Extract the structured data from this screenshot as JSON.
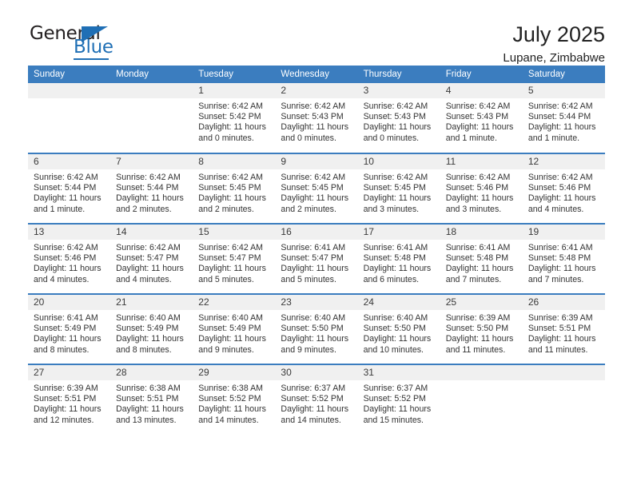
{
  "brand": {
    "name_top": "General",
    "name_bottom": "Blue",
    "accent_color": "#1f6fb5"
  },
  "header": {
    "title": "July 2025",
    "subtitle": "Lupane, Zimbabwe"
  },
  "theme": {
    "header_row_background": "#3b7dbf",
    "header_row_text": "#ffffff",
    "daynum_background": "#f0f0f0",
    "row_divider": "#3b7dbf"
  },
  "calendar": {
    "weekday_headers": [
      "Sunday",
      "Monday",
      "Tuesday",
      "Wednesday",
      "Thursday",
      "Friday",
      "Saturday"
    ],
    "labels": {
      "sunrise": "Sunrise:",
      "sunset": "Sunset:",
      "daylight": "Daylight:"
    },
    "weeks": [
      [
        {
          "day": "",
          "sunrise": "",
          "sunset": "",
          "daylight_1": "",
          "daylight_2": ""
        },
        {
          "day": "",
          "sunrise": "",
          "sunset": "",
          "daylight_1": "",
          "daylight_2": ""
        },
        {
          "day": "1",
          "sunrise": "Sunrise: 6:42 AM",
          "sunset": "Sunset: 5:42 PM",
          "daylight_1": "Daylight: 11 hours",
          "daylight_2": "and 0 minutes."
        },
        {
          "day": "2",
          "sunrise": "Sunrise: 6:42 AM",
          "sunset": "Sunset: 5:43 PM",
          "daylight_1": "Daylight: 11 hours",
          "daylight_2": "and 0 minutes."
        },
        {
          "day": "3",
          "sunrise": "Sunrise: 6:42 AM",
          "sunset": "Sunset: 5:43 PM",
          "daylight_1": "Daylight: 11 hours",
          "daylight_2": "and 0 minutes."
        },
        {
          "day": "4",
          "sunrise": "Sunrise: 6:42 AM",
          "sunset": "Sunset: 5:43 PM",
          "daylight_1": "Daylight: 11 hours",
          "daylight_2": "and 1 minute."
        },
        {
          "day": "5",
          "sunrise": "Sunrise: 6:42 AM",
          "sunset": "Sunset: 5:44 PM",
          "daylight_1": "Daylight: 11 hours",
          "daylight_2": "and 1 minute."
        }
      ],
      [
        {
          "day": "6",
          "sunrise": "Sunrise: 6:42 AM",
          "sunset": "Sunset: 5:44 PM",
          "daylight_1": "Daylight: 11 hours",
          "daylight_2": "and 1 minute."
        },
        {
          "day": "7",
          "sunrise": "Sunrise: 6:42 AM",
          "sunset": "Sunset: 5:44 PM",
          "daylight_1": "Daylight: 11 hours",
          "daylight_2": "and 2 minutes."
        },
        {
          "day": "8",
          "sunrise": "Sunrise: 6:42 AM",
          "sunset": "Sunset: 5:45 PM",
          "daylight_1": "Daylight: 11 hours",
          "daylight_2": "and 2 minutes."
        },
        {
          "day": "9",
          "sunrise": "Sunrise: 6:42 AM",
          "sunset": "Sunset: 5:45 PM",
          "daylight_1": "Daylight: 11 hours",
          "daylight_2": "and 2 minutes."
        },
        {
          "day": "10",
          "sunrise": "Sunrise: 6:42 AM",
          "sunset": "Sunset: 5:45 PM",
          "daylight_1": "Daylight: 11 hours",
          "daylight_2": "and 3 minutes."
        },
        {
          "day": "11",
          "sunrise": "Sunrise: 6:42 AM",
          "sunset": "Sunset: 5:46 PM",
          "daylight_1": "Daylight: 11 hours",
          "daylight_2": "and 3 minutes."
        },
        {
          "day": "12",
          "sunrise": "Sunrise: 6:42 AM",
          "sunset": "Sunset: 5:46 PM",
          "daylight_1": "Daylight: 11 hours",
          "daylight_2": "and 4 minutes."
        }
      ],
      [
        {
          "day": "13",
          "sunrise": "Sunrise: 6:42 AM",
          "sunset": "Sunset: 5:46 PM",
          "daylight_1": "Daylight: 11 hours",
          "daylight_2": "and 4 minutes."
        },
        {
          "day": "14",
          "sunrise": "Sunrise: 6:42 AM",
          "sunset": "Sunset: 5:47 PM",
          "daylight_1": "Daylight: 11 hours",
          "daylight_2": "and 4 minutes."
        },
        {
          "day": "15",
          "sunrise": "Sunrise: 6:42 AM",
          "sunset": "Sunset: 5:47 PM",
          "daylight_1": "Daylight: 11 hours",
          "daylight_2": "and 5 minutes."
        },
        {
          "day": "16",
          "sunrise": "Sunrise: 6:41 AM",
          "sunset": "Sunset: 5:47 PM",
          "daylight_1": "Daylight: 11 hours",
          "daylight_2": "and 5 minutes."
        },
        {
          "day": "17",
          "sunrise": "Sunrise: 6:41 AM",
          "sunset": "Sunset: 5:48 PM",
          "daylight_1": "Daylight: 11 hours",
          "daylight_2": "and 6 minutes."
        },
        {
          "day": "18",
          "sunrise": "Sunrise: 6:41 AM",
          "sunset": "Sunset: 5:48 PM",
          "daylight_1": "Daylight: 11 hours",
          "daylight_2": "and 7 minutes."
        },
        {
          "day": "19",
          "sunrise": "Sunrise: 6:41 AM",
          "sunset": "Sunset: 5:48 PM",
          "daylight_1": "Daylight: 11 hours",
          "daylight_2": "and 7 minutes."
        }
      ],
      [
        {
          "day": "20",
          "sunrise": "Sunrise: 6:41 AM",
          "sunset": "Sunset: 5:49 PM",
          "daylight_1": "Daylight: 11 hours",
          "daylight_2": "and 8 minutes."
        },
        {
          "day": "21",
          "sunrise": "Sunrise: 6:40 AM",
          "sunset": "Sunset: 5:49 PM",
          "daylight_1": "Daylight: 11 hours",
          "daylight_2": "and 8 minutes."
        },
        {
          "day": "22",
          "sunrise": "Sunrise: 6:40 AM",
          "sunset": "Sunset: 5:49 PM",
          "daylight_1": "Daylight: 11 hours",
          "daylight_2": "and 9 minutes."
        },
        {
          "day": "23",
          "sunrise": "Sunrise: 6:40 AM",
          "sunset": "Sunset: 5:50 PM",
          "daylight_1": "Daylight: 11 hours",
          "daylight_2": "and 9 minutes."
        },
        {
          "day": "24",
          "sunrise": "Sunrise: 6:40 AM",
          "sunset": "Sunset: 5:50 PM",
          "daylight_1": "Daylight: 11 hours",
          "daylight_2": "and 10 minutes."
        },
        {
          "day": "25",
          "sunrise": "Sunrise: 6:39 AM",
          "sunset": "Sunset: 5:50 PM",
          "daylight_1": "Daylight: 11 hours",
          "daylight_2": "and 11 minutes."
        },
        {
          "day": "26",
          "sunrise": "Sunrise: 6:39 AM",
          "sunset": "Sunset: 5:51 PM",
          "daylight_1": "Daylight: 11 hours",
          "daylight_2": "and 11 minutes."
        }
      ],
      [
        {
          "day": "27",
          "sunrise": "Sunrise: 6:39 AM",
          "sunset": "Sunset: 5:51 PM",
          "daylight_1": "Daylight: 11 hours",
          "daylight_2": "and 12 minutes."
        },
        {
          "day": "28",
          "sunrise": "Sunrise: 6:38 AM",
          "sunset": "Sunset: 5:51 PM",
          "daylight_1": "Daylight: 11 hours",
          "daylight_2": "and 13 minutes."
        },
        {
          "day": "29",
          "sunrise": "Sunrise: 6:38 AM",
          "sunset": "Sunset: 5:52 PM",
          "daylight_1": "Daylight: 11 hours",
          "daylight_2": "and 14 minutes."
        },
        {
          "day": "30",
          "sunrise": "Sunrise: 6:37 AM",
          "sunset": "Sunset: 5:52 PM",
          "daylight_1": "Daylight: 11 hours",
          "daylight_2": "and 14 minutes."
        },
        {
          "day": "31",
          "sunrise": "Sunrise: 6:37 AM",
          "sunset": "Sunset: 5:52 PM",
          "daylight_1": "Daylight: 11 hours",
          "daylight_2": "and 15 minutes."
        },
        {
          "day": "",
          "sunrise": "",
          "sunset": "",
          "daylight_1": "",
          "daylight_2": ""
        },
        {
          "day": "",
          "sunrise": "",
          "sunset": "",
          "daylight_1": "",
          "daylight_2": ""
        }
      ]
    ]
  }
}
